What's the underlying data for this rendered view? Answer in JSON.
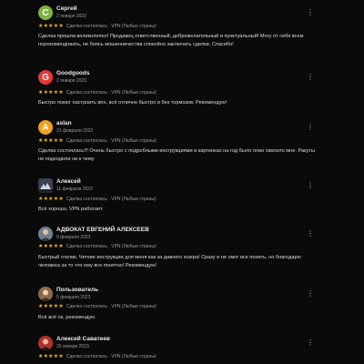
{
  "reviews": [
    {
      "name": "Сергей",
      "date": "2 января 2023",
      "avatar_letter": "С",
      "avatar_color": "#7cb342",
      "stars": "★★★★★",
      "badge": "Сделка состоялась · VPN (Любые страны)",
      "text": "Сделка прошла великолепно! Продавец ответственный, доброжелательный и пунктуальный! Могу от себя всем порекомендовать, не боясь мошенничества спокойно заключать сделки. Спасибо!"
    },
    {
      "name": "Goodgoods",
      "date": "2 января 2023",
      "avatar_letter": "G",
      "avatar_color": "#e53935",
      "stars": "★★★★★",
      "badge": "Сделка состоялась · VPN (Любые страны)",
      "text": "Быстро помог настроить впн, всё отлично быстро и без тормозов. Рекомендую!"
    },
    {
      "name": "aslan",
      "date": "31 февраля 2023",
      "avatar_letter": "A",
      "avatar_color": "#f0a020",
      "stars": "★★★★★",
      "badge": "Сделка состоялась · VPN (Любые страны)",
      "text": "Сделка состоялась!!! Очень быстро с подробными инструкциями в картинках на год было план хватило мне. Ракуты не подходили ни к чему"
    },
    {
      "name": "Алексей",
      "date": "11 февраля 2023",
      "stars": "★★★★★",
      "badge": "Сделка состоялась · VPN (Любые страны)",
      "text": "Всё хорошо, VPN работает."
    },
    {
      "name": "АДВОКАТ ЕВГЕНИЙ АЛЕКСЕЕВ",
      "date": "9 февраля 2023",
      "stars": "★★★★★",
      "badge": "Сделка состоялась · VPN (Любые страны)",
      "text": "Быстрый отклик. Четкие инструкции для меня как за давнего юзера! Сразу и не смог все понять, но благодарю человека за то что ему все понятно! Рекомендую!"
    },
    {
      "name": "Пользователь",
      "date": "5 февраля 2023",
      "stars": "★★★★★",
      "badge": "Сделка состоялась · VPN (Любые страны)",
      "text": "Всё всё ок, рекомендую"
    },
    {
      "name": "Алексей Саватеев",
      "date": "26 января 2023",
      "stars": "★★★★★",
      "badge": "Сделка состоялась · VPN (Любые страны)",
      "text": ""
    }
  ],
  "menu_glyph": "⋮"
}
